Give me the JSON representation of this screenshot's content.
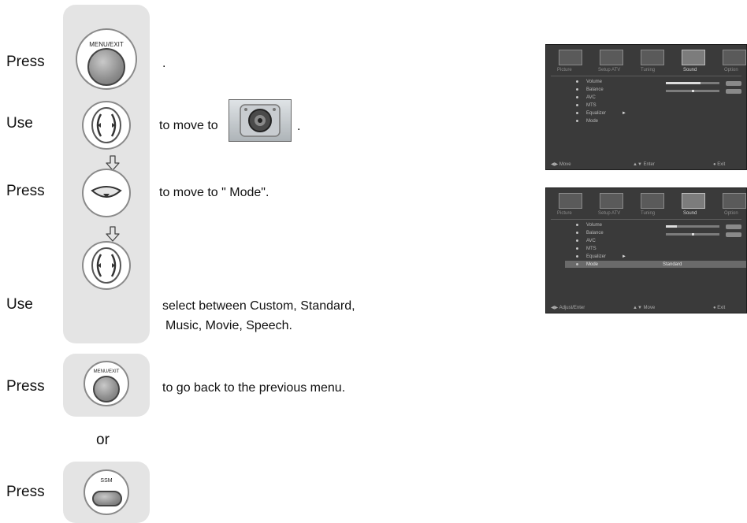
{
  "steps": [
    {
      "action": "Press",
      "text": "."
    },
    {
      "action": "Use",
      "text": "to move to",
      "suffix": "."
    },
    {
      "action": "Press",
      "text": "to move to \" Mode\"."
    },
    {
      "action": "Use",
      "text_line1": "select between Custom, Standard,",
      "text_line2": "Music, Movie, Speech."
    },
    {
      "action": "Press",
      "text": "to go back to the previous menu."
    },
    {
      "action": "Press"
    }
  ],
  "or_label": "or",
  "buttons": {
    "menu_exit": "MENU/EXIT",
    "ssm": "SSM"
  },
  "screen1": {
    "tabs": [
      "Picture",
      "Setup ATV",
      "Tuning",
      "Sound",
      "Option"
    ],
    "selected_tab": "Sound",
    "items": [
      "Volume",
      "Balance",
      "AVC",
      "MTS",
      "Equalizer",
      "Mode"
    ],
    "volume_level": 0.65,
    "balance_level": 0.5,
    "footer": {
      "left": "Move",
      "center": "Enter",
      "right": "Exit"
    }
  },
  "screen2": {
    "tabs": [
      "Picture",
      "Setup ATV",
      "Tuning",
      "Sound",
      "Option"
    ],
    "selected_tab": "Sound",
    "items": [
      "Volume",
      "Balance",
      "AVC",
      "MTS",
      "Equalizer",
      "Mode"
    ],
    "highlighted_item": "Mode",
    "mode_value": "Standard",
    "volume_level": 0.2,
    "balance_level": 0.5,
    "footer": {
      "left": "Adjust/Enter",
      "center": "Move",
      "right": "Exit"
    }
  },
  "colors": {
    "panel": "#e4e4e4",
    "screen_bg": "#3a3a3a",
    "text": "#111111"
  }
}
